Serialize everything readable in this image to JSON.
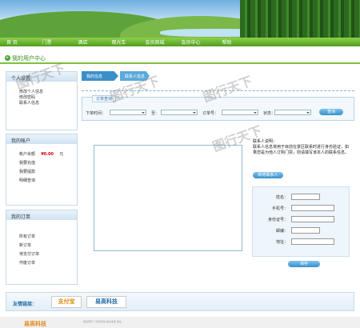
{
  "nav": {
    "items": [
      "首 页",
      "门票",
      "酒店",
      "观光车",
      "会员商城",
      "会员中心",
      "帮助"
    ]
  },
  "page_title": "我的用户中心",
  "sidebar_personal": {
    "title": "个人设置",
    "items": [
      "修改个人信息",
      "修改密码",
      "联系人信息"
    ]
  },
  "sidebar_account": {
    "title": "我的帐户",
    "balance_label": "帐户余额",
    "balance_value": "¥0.00",
    "balance_unit": "元",
    "items": [
      "我要充值",
      "我要提款",
      "明细查询"
    ]
  },
  "sidebar_orders": {
    "title": "我的订单",
    "items": [
      "所有订单",
      "新订单",
      "待支付订单",
      "作废订单"
    ]
  },
  "tabs": [
    "我的信息",
    "联系人信息"
  ],
  "search": {
    "legend": "订单查询",
    "time_label": "下单时间：",
    "to_label": "至：",
    "order_no_label": "订单号：",
    "status_label": "状态：",
    "button": "查询"
  },
  "contact_info": {
    "title": "联系人说明：",
    "text": "联系人信息将用于目前在景区联系时进行身份验证，如果您是为他人订购门票，则请填写该本人的联系信息。",
    "add_button": "新增联系人"
  },
  "form": {
    "fields": [
      "姓名：",
      "手机号：",
      "身份证号：",
      "邮编：",
      "地址："
    ],
    "submit": "保存"
  },
  "links": {
    "label": "友情链接：",
    "logos": [
      "支付宝",
      "易高科技"
    ]
  },
  "footer": {
    "logo": "易高科技",
    "text": "版权所有 ©易高科技 联系电话 地址"
  },
  "watermark": "图行天下"
}
